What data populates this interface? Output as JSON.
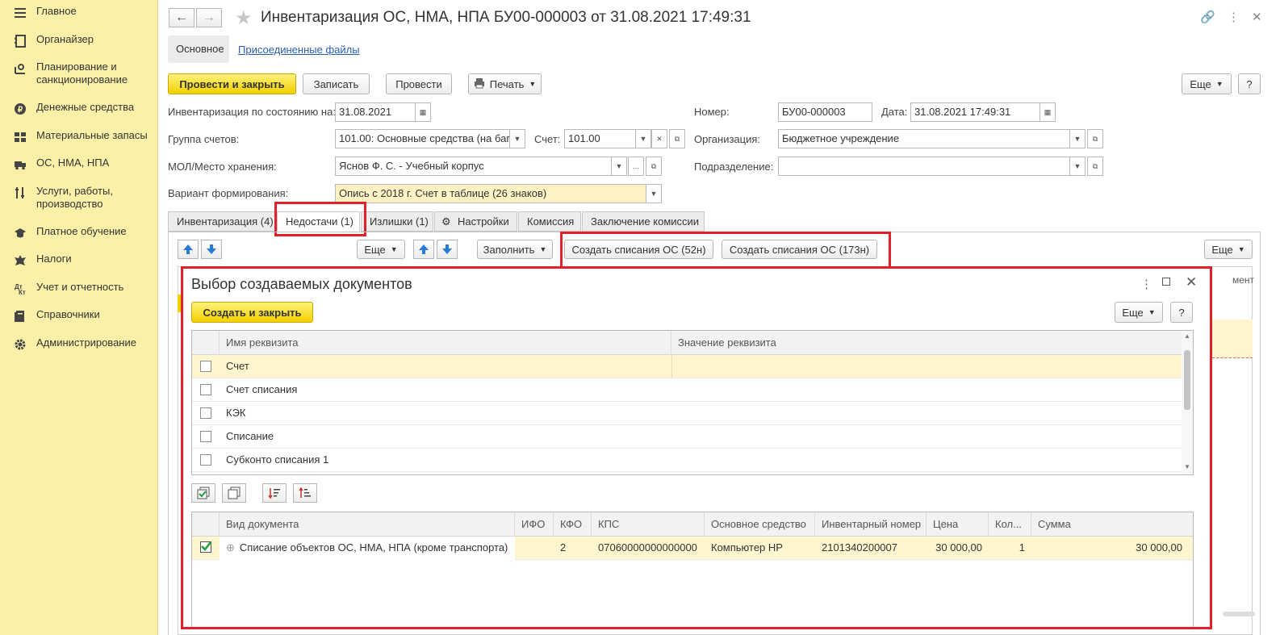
{
  "sidebar": {
    "items": [
      {
        "label": "Главное",
        "icon": "menu-icon"
      },
      {
        "label": "Органайзер",
        "icon": "notebook-icon"
      },
      {
        "label": "Планирование и санкционирование",
        "icon": "planning-icon"
      },
      {
        "label": "Денежные средства",
        "icon": "coin-icon"
      },
      {
        "label": "Материальные запасы",
        "icon": "warehouse-icon"
      },
      {
        "label": "ОС, НМА, НПА",
        "icon": "truck-icon"
      },
      {
        "label": "Услуги, работы, производство",
        "icon": "tools-icon"
      },
      {
        "label": "Платное обучение",
        "icon": "graduation-cap-icon"
      },
      {
        "label": "Налоги",
        "icon": "emblem-icon"
      },
      {
        "label": "Учет и отчетность",
        "icon": "accounting-icon"
      },
      {
        "label": "Справочники",
        "icon": "books-icon"
      },
      {
        "label": "Администрирование",
        "icon": "gear-icon"
      }
    ]
  },
  "header": {
    "title": "Инвентаризация ОС, НМА, НПА БУ00-000003 от 31.08.2021 17:49:31",
    "tab_main": "Основное",
    "tab_files": "Присоединенные файлы"
  },
  "toolbar": {
    "post_close": "Провести и закрыть",
    "save": "Записать",
    "post": "Провести",
    "print": "Печать",
    "more": "Еще",
    "help": "?"
  },
  "form": {
    "inv_date_label": "Инвентаризация по состоянию на:",
    "inv_date_value": "31.08.2021",
    "number_label": "Номер:",
    "number_value": "БУ00-000003",
    "date_label": "Дата:",
    "date_value": "31.08.2021 17:49:31",
    "group_label": "Группа счетов:",
    "group_value": "101.00: Основные средства (на баг",
    "account_label": "Счет:",
    "account_value": "101.00",
    "org_label": "Организация:",
    "org_value": "Бюджетное учреждение",
    "mol_label": "МОЛ/Место хранения:",
    "mol_value": "Яснов Ф. С. - Учебный корпус",
    "dept_label": "Подразделение:",
    "dept_value": "",
    "variant_label": "Вариант формирования:",
    "variant_value": "Опись с 2018 г. Счет в таблице (26 знаков)"
  },
  "tabs": [
    {
      "label": "Инвентаризация (4)"
    },
    {
      "label": "Недостачи (1)"
    },
    {
      "label": "Излишки (1)"
    },
    {
      "label": "Настройки"
    },
    {
      "label": "Комиссия"
    },
    {
      "label": "Заключение комиссии"
    }
  ],
  "subtoolbar": {
    "more": "Еще",
    "fill": "Заполнить",
    "create_52": "Создать списания ОС (52н)",
    "create_173": "Создать списания ОС (173н)",
    "more_right": "Еще",
    "right_col_fragment": "мент"
  },
  "dialog": {
    "title": "Выбор создаваемых документов",
    "create_close": "Создать и закрыть",
    "more": "Еще",
    "help": "?",
    "attr_headers": [
      "Имя реквизита",
      "Значение реквизита"
    ],
    "attr_rows": [
      {
        "name": "Счет",
        "value": "",
        "checked": false
      },
      {
        "name": "Счет списания",
        "value": "",
        "checked": false
      },
      {
        "name": "КЭК",
        "value": "",
        "checked": false
      },
      {
        "name": "Списание",
        "value": "",
        "checked": false
      },
      {
        "name": "Субконто списания 1",
        "value": "",
        "checked": false
      }
    ],
    "doc_headers": [
      "Вид документа",
      "ИФО",
      "КФО",
      "КПС",
      "Основное средство",
      "Инвентарный номер",
      "Цена",
      "Кол...",
      "Сумма"
    ],
    "doc_rows": [
      {
        "type": "Списание объектов ОС, НМА, НПА (кроме транспорта)",
        "ifo": "",
        "kfo": "2",
        "kps": "07060000000000000",
        "asset": "Компьютер HP",
        "inv": "2101340200007",
        "price": "30 000,00",
        "qty": "1",
        "sum": "30 000,00",
        "checked": true
      }
    ]
  },
  "colors": {
    "sidebar_bg": "#fbf0a8",
    "accent_yellow": "#f2d000",
    "highlight_red": "#e0202a",
    "selected_row": "#fff6cf",
    "link_blue": "#2a5db0"
  }
}
